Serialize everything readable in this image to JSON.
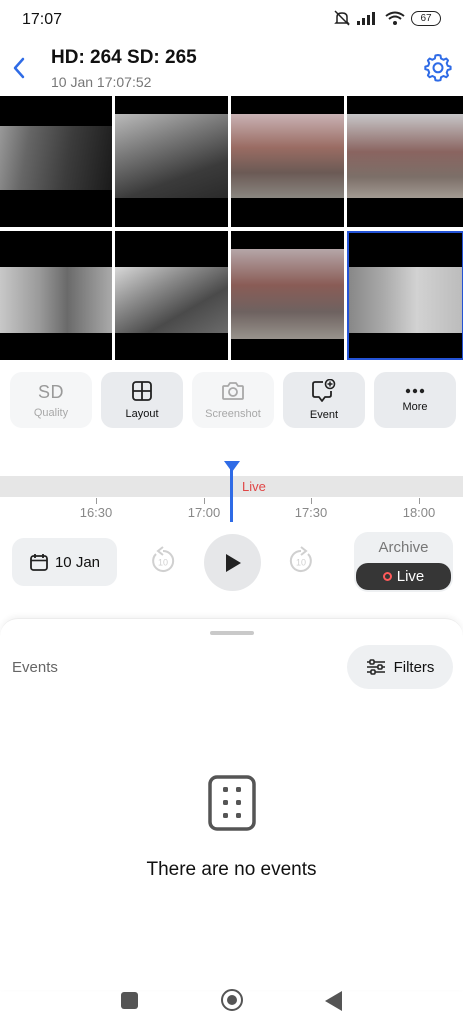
{
  "status_bar": {
    "time": "17:07",
    "battery": "67"
  },
  "header": {
    "title": "HD: 264 SD: 265",
    "subtitle": "10 Jan 17:07:52"
  },
  "cameras": [
    "cam-1",
    "cam-2",
    "cam-3",
    "cam-4",
    "cam-5",
    "cam-6",
    "cam-7",
    "cam-8"
  ],
  "controls": {
    "quality_value": "SD",
    "quality_label": "Quality",
    "layout_label": "Layout",
    "screenshot_label": "Screenshot",
    "event_label": "Event",
    "more_label": "More"
  },
  "timeline": {
    "live_label": "Live",
    "ticks": [
      "16:30",
      "17:00",
      "17:30",
      "18:00"
    ]
  },
  "player": {
    "date_label": "10 Jan",
    "skip_back_label": "10",
    "skip_forward_label": "10",
    "archive_label": "Archive",
    "live_label": "Live"
  },
  "events": {
    "title": "Events",
    "filters_label": "Filters",
    "empty_text": "There are no events"
  },
  "colors": {
    "accent": "#2f6be6",
    "live": "#e04646",
    "selected_border": "#2453d6"
  }
}
